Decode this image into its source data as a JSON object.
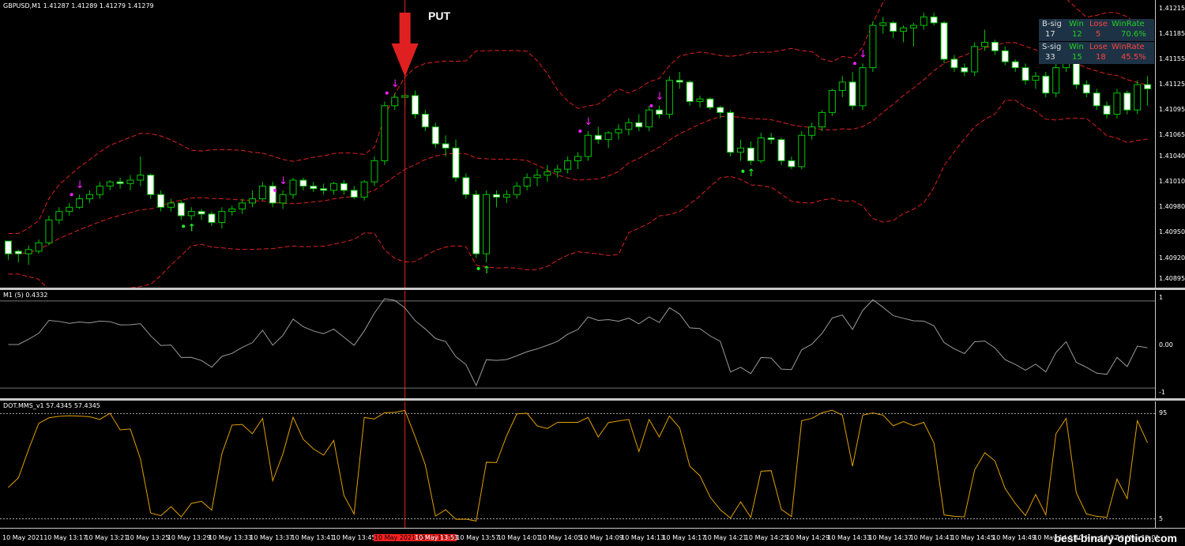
{
  "symbol_header": "GBPUSD,M1  1.41287 1.41289 1.41279 1.41279",
  "put_label": "PUT",
  "osc1_title": "M1 (5) 0.4332",
  "osc2_title": "DOT.MMS_v1 57.4345 57.4345",
  "price_axis": [
    "1.41215",
    "1.41185",
    "1.41155",
    "1.41125",
    "1.41095",
    "1.41065",
    "1.41040",
    "1.41010",
    "1.40980",
    "1.40950",
    "1.40920",
    "1.40895"
  ],
  "osc1_axis": [
    "1",
    "0.00",
    "-1"
  ],
  "osc2_axis": [
    "95",
    "5"
  ],
  "time_axis": [
    "10 May 2021",
    "10 May 13:17",
    "10 May 13:21",
    "10 May 13:25",
    "10 May 13:29",
    "10 May 13:33",
    "10 May 13:37",
    "10 May 13:41",
    "10 May 13:45",
    "10 May 2021.05.10 13:50",
    "10 May 13:53",
    "10 May 13:57",
    "10 May 14:01",
    "10 May 14:05",
    "10 May 14:09",
    "10 May 14:13",
    "10 May 14:17",
    "10 May 14:21",
    "10 May 14:25",
    "10 May 14:29",
    "10 May 14:33",
    "10 May 14:37",
    "10 May 14:41",
    "10 May 14:45",
    "10 May 14:49",
    "10 May 14:53",
    "10 May 14:57",
    "10 May 15:01"
  ],
  "highlighted_time": "10 May 2021.05.10 13:50",
  "stats": {
    "buy": {
      "sig_label": "B-sig",
      "win_label": "Win",
      "lose_label": "Lose",
      "rate_label": "WinRate",
      "sig": "17",
      "win": "12",
      "lose": "5",
      "rate": "70.6%"
    },
    "sell": {
      "sig_label": "S-sig",
      "win_label": "Win",
      "lose_label": "Lose",
      "rate_label": "WinRate",
      "sig": "33",
      "win": "15",
      "lose": "18",
      "rate": "45.5%"
    }
  },
  "watermark": "best-binary-option.com",
  "colors": {
    "bull_candle": "#00c800",
    "bear_candle": "#ffffff",
    "band": "#e02020",
    "osc1_line": "#9a9a9a",
    "osc2_line": "#e0a000",
    "sell_marker": "#ff20ff",
    "buy_marker": "#20ff20",
    "put_arrow": "#e02020",
    "win_green": "#20d020",
    "lose_red": "#ff4040",
    "stats_bg": "#1d3345"
  },
  "candles": [
    [
      1.4094,
      1.4094,
      1.40918,
      1.40925
    ],
    [
      1.40928,
      1.4093,
      1.40915,
      1.40925
    ],
    [
      1.40925,
      1.40935,
      1.40912,
      1.4093
    ],
    [
      1.40928,
      1.40942,
      1.40925,
      1.40938
    ],
    [
      1.40938,
      1.4097,
      1.40935,
      1.40965
    ],
    [
      1.40965,
      1.4098,
      1.4096,
      1.40975
    ],
    [
      1.40975,
      1.40985,
      1.4097,
      1.4098
    ],
    [
      1.4098,
      1.40995,
      1.40978,
      1.4099
    ],
    [
      1.4099,
      1.41,
      1.40985,
      1.40995
    ],
    [
      1.40995,
      1.4101,
      1.4099,
      1.41005
    ],
    [
      1.41005,
      1.41012,
      1.41,
      1.4101
    ],
    [
      1.4101,
      1.41015,
      1.41002,
      1.41008
    ],
    [
      1.41008,
      1.41018,
      1.41,
      1.41012
    ],
    [
      1.41012,
      1.4104,
      1.41005,
      1.41018
    ],
    [
      1.41018,
      1.4102,
      1.4099,
      1.40995
    ],
    [
      1.40995,
      1.41,
      1.40975,
      1.4098
    ],
    [
      1.4098,
      1.4099,
      1.40975,
      1.40985
    ],
    [
      1.40985,
      1.40988,
      1.40965,
      1.4097
    ],
    [
      1.4097,
      1.4098,
      1.40965,
      1.40975
    ],
    [
      1.40975,
      1.40978,
      1.40965,
      1.40972
    ],
    [
      1.40972,
      1.40975,
      1.40958,
      1.40962
    ],
    [
      1.40962,
      1.4098,
      1.40955,
      1.40975
    ],
    [
      1.40975,
      1.40982,
      1.4097,
      1.40978
    ],
    [
      1.40978,
      1.4099,
      1.40972,
      1.40985
    ],
    [
      1.40985,
      1.41,
      1.4098,
      1.4099
    ],
    [
      1.4099,
      1.4101,
      1.40988,
      1.41005
    ],
    [
      1.41005,
      1.4101,
      1.4098,
      1.40985
    ],
    [
      1.40985,
      1.41,
      1.40978,
      1.40995
    ],
    [
      1.40995,
      1.41015,
      1.4099,
      1.41012
    ],
    [
      1.41012,
      1.41015,
      1.41,
      1.41005
    ],
    [
      1.41005,
      1.4101,
      1.40998,
      1.41002
    ],
    [
      1.41002,
      1.41008,
      1.40995,
      1.41
    ],
    [
      1.41,
      1.4101,
      1.40995,
      1.41008
    ],
    [
      1.41008,
      1.41012,
      1.40995,
      1.41
    ],
    [
      1.41,
      1.41005,
      1.4099,
      1.40992
    ],
    [
      1.40992,
      1.41012,
      1.40988,
      1.4101
    ],
    [
      1.4101,
      1.4104,
      1.41005,
      1.41035
    ],
    [
      1.41035,
      1.41105,
      1.4103,
      1.411
    ],
    [
      1.411,
      1.41115,
      1.41095,
      1.4111
    ],
    [
      1.4111,
      1.41115,
      1.411,
      1.41112
    ],
    [
      1.41112,
      1.41118,
      1.41085,
      1.4109
    ],
    [
      1.4109,
      1.41095,
      1.4107,
      1.41075
    ],
    [
      1.41075,
      1.4108,
      1.4105,
      1.41055
    ],
    [
      1.41055,
      1.41065,
      1.4104,
      1.4105
    ],
    [
      1.4105,
      1.4106,
      1.4101,
      1.41015
    ],
    [
      1.41015,
      1.4102,
      1.4099,
      1.40995
    ],
    [
      1.40995,
      1.41,
      1.4092,
      1.40925
    ],
    [
      1.40925,
      1.41,
      1.40915,
      1.40995
    ],
    [
      1.40995,
      1.41,
      1.4098,
      1.40992
    ],
    [
      1.40992,
      1.41,
      1.40985,
      1.40995
    ],
    [
      1.40995,
      1.4101,
      1.4099,
      1.41005
    ],
    [
      1.41005,
      1.4102,
      1.41,
      1.41015
    ],
    [
      1.41015,
      1.41025,
      1.41005,
      1.41018
    ],
    [
      1.41018,
      1.4103,
      1.4101,
      1.41022
    ],
    [
      1.41022,
      1.4103,
      1.41015,
      1.41025
    ],
    [
      1.41025,
      1.4104,
      1.4102,
      1.41035
    ],
    [
      1.41035,
      1.41045,
      1.41025,
      1.4104
    ],
    [
      1.4104,
      1.4107,
      1.41035,
      1.41065
    ],
    [
      1.41065,
      1.41075,
      1.41055,
      1.4106
    ],
    [
      1.4106,
      1.4107,
      1.4105,
      1.41068
    ],
    [
      1.41068,
      1.41078,
      1.4106,
      1.41072
    ],
    [
      1.41072,
      1.41085,
      1.41065,
      1.4108
    ],
    [
      1.4108,
      1.4109,
      1.4107,
      1.41075
    ],
    [
      1.41075,
      1.411,
      1.4107,
      1.41095
    ],
    [
      1.41095,
      1.411,
      1.41085,
      1.4109
    ],
    [
      1.4109,
      1.41135,
      1.41085,
      1.4113
    ],
    [
      1.4113,
      1.4114,
      1.4112,
      1.41128
    ],
    [
      1.41128,
      1.4113,
      1.411,
      1.41105
    ],
    [
      1.41105,
      1.41112,
      1.41098,
      1.41108
    ],
    [
      1.41108,
      1.4111,
      1.41095,
      1.41098
    ],
    [
      1.41098,
      1.411,
      1.41085,
      1.41092
    ],
    [
      1.41092,
      1.41095,
      1.4104,
      1.41045
    ],
    [
      1.41045,
      1.4106,
      1.41035,
      1.4105
    ],
    [
      1.4105,
      1.41058,
      1.4103,
      1.41035
    ],
    [
      1.41035,
      1.41068,
      1.41032,
      1.41062
    ],
    [
      1.41062,
      1.41068,
      1.41055,
      1.4106
    ],
    [
      1.4106,
      1.41062,
      1.4103,
      1.41035
    ],
    [
      1.41035,
      1.4104,
      1.41025,
      1.41028
    ],
    [
      1.41028,
      1.4107,
      1.41025,
      1.41065
    ],
    [
      1.41065,
      1.4108,
      1.4106,
      1.41075
    ],
    [
      1.41075,
      1.41095,
      1.4107,
      1.41092
    ],
    [
      1.41092,
      1.4112,
      1.41088,
      1.41118
    ],
    [
      1.41118,
      1.41135,
      1.4111,
      1.41128
    ],
    [
      1.41128,
      1.4114,
      1.41095,
      1.411
    ],
    [
      1.411,
      1.4115,
      1.41095,
      1.41145
    ],
    [
      1.41145,
      1.412,
      1.4114,
      1.41195
    ],
    [
      1.41195,
      1.41205,
      1.41185,
      1.41198
    ],
    [
      1.41198,
      1.412,
      1.4118,
      1.41188
    ],
    [
      1.41188,
      1.41195,
      1.41175,
      1.41192
    ],
    [
      1.41192,
      1.41198,
      1.4117,
      1.41195
    ],
    [
      1.41195,
      1.4121,
      1.4119,
      1.41205
    ],
    [
      1.41205,
      1.4121,
      1.41195,
      1.41198
    ],
    [
      1.41198,
      1.412,
      1.4115,
      1.41155
    ],
    [
      1.41155,
      1.4116,
      1.4114,
      1.41145
    ],
    [
      1.41145,
      1.4115,
      1.41135,
      1.4114
    ],
    [
      1.4114,
      1.41175,
      1.41135,
      1.4117
    ],
    [
      1.4117,
      1.4119,
      1.41165,
      1.41175
    ],
    [
      1.41175,
      1.41178,
      1.4116,
      1.41165
    ],
    [
      1.41165,
      1.4117,
      1.41148,
      1.41152
    ],
    [
      1.41152,
      1.41155,
      1.4114,
      1.41145
    ],
    [
      1.41145,
      1.4115,
      1.41125,
      1.4113
    ],
    [
      1.4113,
      1.4114,
      1.4112,
      1.41135
    ],
    [
      1.41135,
      1.4114,
      1.4111,
      1.41115
    ],
    [
      1.41115,
      1.4115,
      1.4111,
      1.41145
    ],
    [
      1.41145,
      1.41165,
      1.4114,
      1.4116
    ],
    [
      1.4116,
      1.41162,
      1.4112,
      1.41125
    ],
    [
      1.41125,
      1.4113,
      1.4111,
      1.41115
    ],
    [
      1.41115,
      1.4112,
      1.41095,
      1.411
    ],
    [
      1.411,
      1.41105,
      1.41085,
      1.4109
    ],
    [
      1.4109,
      1.4112,
      1.41085,
      1.41115
    ],
    [
      1.41115,
      1.41118,
      1.4109,
      1.41095
    ],
    [
      1.41095,
      1.4113,
      1.4109,
      1.41125
    ],
    [
      1.41125,
      1.41135,
      1.411,
      1.4112
    ]
  ]
}
